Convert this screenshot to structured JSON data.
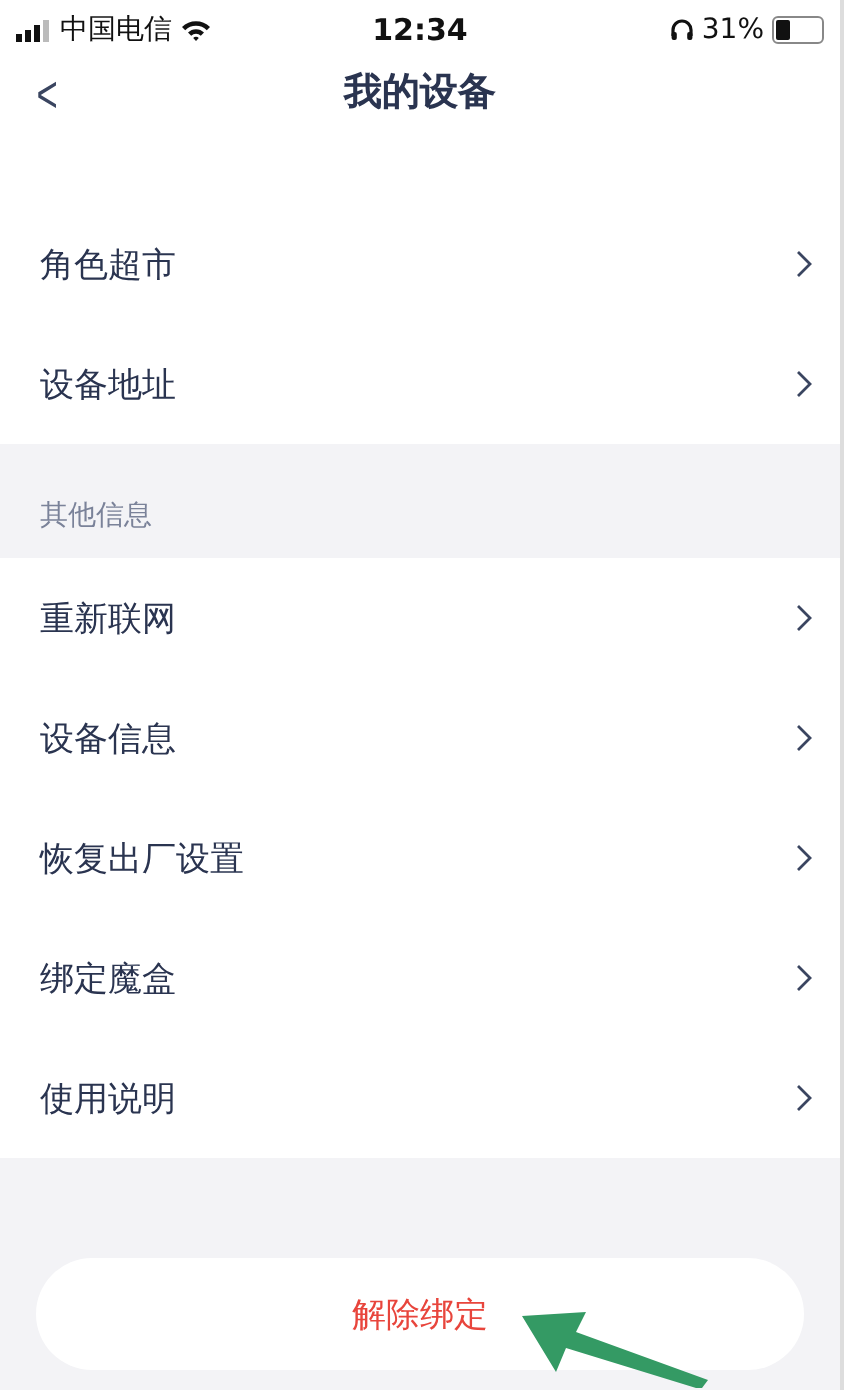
{
  "status_bar": {
    "carrier": "中国电信",
    "time": "12:34",
    "battery": "31%"
  },
  "nav": {
    "back": "<",
    "title": "我的设备"
  },
  "groups": [
    {
      "items": [
        {
          "label": "角色超市"
        },
        {
          "label": "设备地址"
        }
      ]
    },
    {
      "header": "其他信息",
      "items": [
        {
          "label": "重新联网"
        },
        {
          "label": "设备信息"
        },
        {
          "label": "恢复出厂设置"
        },
        {
          "label": "绑定魔盒"
        },
        {
          "label": "使用说明"
        }
      ]
    }
  ],
  "unbind_button": "解除绑定"
}
